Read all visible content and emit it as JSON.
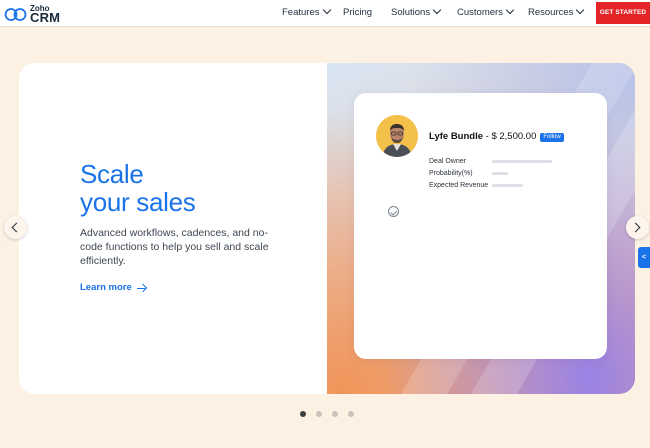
{
  "brand": {
    "small": "Zoho",
    "big": "CRM"
  },
  "nav": {
    "items": [
      {
        "label": "Features",
        "dropdown": true
      },
      {
        "label": "Pricing",
        "dropdown": false
      },
      {
        "label": "Solutions",
        "dropdown": true
      },
      {
        "label": "Customers",
        "dropdown": true
      },
      {
        "label": "Resources",
        "dropdown": true
      }
    ],
    "cta": "GET STARTED"
  },
  "hero": {
    "headline_line1": "Scale",
    "headline_line2": "your sales",
    "description": "Advanced workflows, cadences, and no-code functions to help you sell and scale efficiently.",
    "link": "Learn more"
  },
  "deal_card": {
    "name": "Lyfe Bundle",
    "amount": "- $ 2,500.00",
    "follow": "Follow",
    "fields": [
      "Deal Owner",
      "Probability(%)",
      "Expected Revenue"
    ]
  },
  "carousel": {
    "slides": 4,
    "active": 1
  },
  "side_tab": {
    "label": "<"
  },
  "colors": {
    "accent": "#1a73e8",
    "cta": "#e42527",
    "background": "#fdf1e4"
  }
}
